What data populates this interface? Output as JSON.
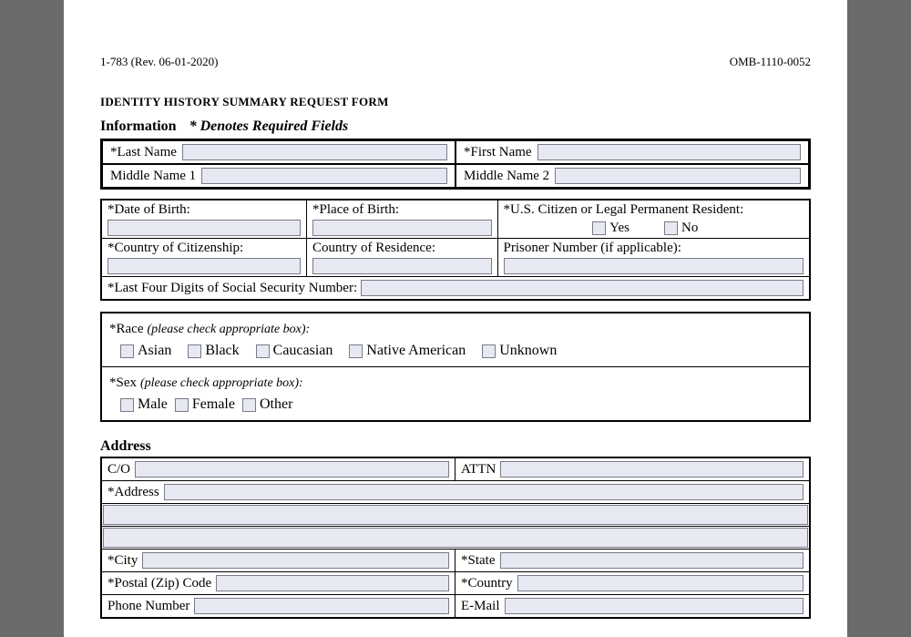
{
  "header": {
    "form_number": "1-783 (Rev. 06-01-2020)",
    "omb": "OMB-1110-0052"
  },
  "title": "IDENTITY HISTORY SUMMARY REQUEST FORM",
  "info_section": {
    "heading": "Information",
    "note": "* Denotes Required Fields",
    "last_name": "*Last Name",
    "first_name": "*First Name",
    "middle1": "Middle Name 1",
    "middle2": "Middle Name 2"
  },
  "birth_section": {
    "dob": "*Date of Birth:",
    "pob": "*Place of Birth:",
    "citizen": "*U.S. Citizen or Legal Permanent Resident:",
    "yes": "Yes",
    "no": "No",
    "coc": "*Country of Citizenship:",
    "cor": "Country of Residence:",
    "prisoner": "Prisoner Number (if applicable):",
    "ssn": "*Last Four Digits of Social Security Number:"
  },
  "demo_section": {
    "race_label": "*Race",
    "race_hint": "(please check appropriate box):",
    "race_opts": [
      "Asian",
      "Black",
      "Caucasian",
      "Native American",
      "Unknown"
    ],
    "sex_label": "*Sex",
    "sex_hint": "(please check appropriate box):",
    "sex_opts": [
      "Male",
      "Female",
      "Other"
    ]
  },
  "address_section": {
    "heading": "Address",
    "co": "C/O",
    "attn": "ATTN",
    "address": "*Address",
    "city": "*City",
    "state": "*State",
    "zip": "*Postal (Zip) Code",
    "country": "*Country",
    "phone": "Phone Number",
    "email": "E-Mail"
  }
}
